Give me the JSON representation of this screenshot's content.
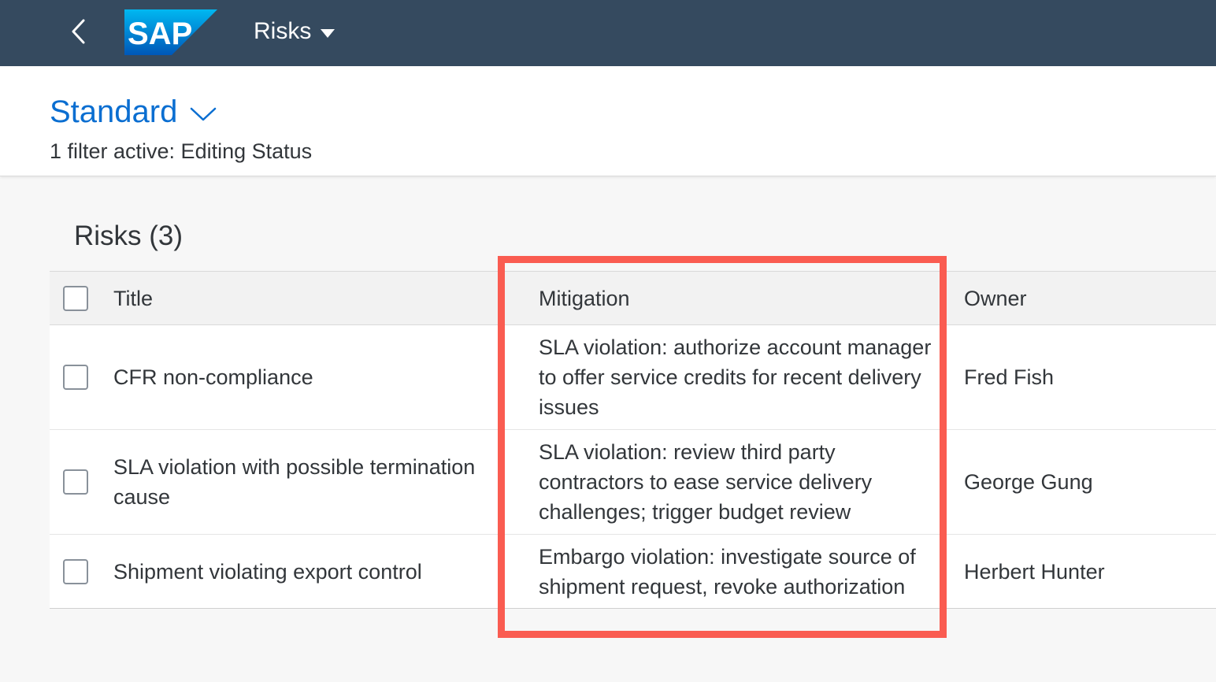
{
  "shellbar": {
    "back_icon": "chevron-left-icon",
    "logo_text": "SAP",
    "app_title": "Risks",
    "menu_icon": "caret-down-icon"
  },
  "header": {
    "variant_name": "Standard",
    "variant_icon": "chevron-down-icon",
    "filter_info": "1 filter active: Editing Status"
  },
  "table": {
    "title": "Risks (3)",
    "columns": [
      "Title",
      "Mitigation",
      "Owner"
    ],
    "rows": [
      {
        "title": "CFR non-compliance",
        "mitigation": "SLA violation: authorize account manager to offer service credits for recent delivery issues",
        "owner": "Fred Fish"
      },
      {
        "title": "SLA violation with possible termination cause",
        "mitigation": "SLA violation: review third party contractors to ease service delivery challenges; trigger budget review",
        "owner": "George Gung"
      },
      {
        "title": "Shipment violating export control",
        "mitigation": "Embargo violation: investigate source of shipment request, revoke authorization",
        "owner": "Herbert Hunter"
      }
    ]
  },
  "colors": {
    "shell": "#354a5f",
    "accent": "#0a6ed1",
    "highlight": "#fa5c51"
  }
}
